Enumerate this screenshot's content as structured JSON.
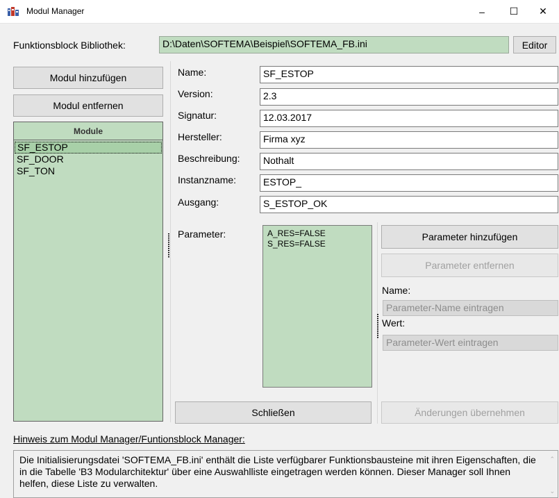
{
  "window": {
    "title": "Modul Manager",
    "minimize": "–",
    "maximize": "☐",
    "close": "✕"
  },
  "library": {
    "label": "Funktionsblock Bibliothek:",
    "path": "D:\\Daten\\SOFTEMA\\Beispiel\\SOFTEMA_FB.ini",
    "editor_button": "Editor"
  },
  "modules": {
    "add_button": "Modul hinzufügen",
    "remove_button": "Modul entfernen",
    "header": "Module",
    "items": [
      "SF_ESTOP",
      "SF_DOOR",
      "SF_TON"
    ],
    "selected_index": 0
  },
  "details": {
    "name_label": "Name:",
    "name_value": "SF_ESTOP",
    "version_label": "Version:",
    "version_value": "2.3",
    "signature_label": "Signatur:",
    "signature_value": "12.03.2017",
    "manufacturer_label": "Hersteller:",
    "manufacturer_value": "Firma xyz",
    "description_label": "Beschreibung:",
    "description_value": "Nothalt",
    "instance_label": "Instanzname:",
    "instance_value": "ESTOP_",
    "output_label": "Ausgang:",
    "output_value": "S_ESTOP_OK"
  },
  "parameters": {
    "label": "Parameter:",
    "items": [
      "A_RES=FALSE",
      "S_RES=FALSE"
    ],
    "add_button": "Parameter hinzufügen",
    "remove_button": "Parameter entfernen",
    "name_label": "Name:",
    "name_placeholder": "Parameter-Name eintragen",
    "value_label": "Wert:",
    "value_placeholder": "Parameter-Wert eintragen"
  },
  "actions": {
    "close_button": "Schließen",
    "apply_button": "Änderungen übernehmen"
  },
  "hint": {
    "title": "Hinweis zum Modul Manager/Funtionsblock Manager:",
    "text": "Die Initialisierungsdatei 'SOFTEMA_FB.ini' enthält die Liste verfügbarer Funktionsbausteine mit ihren Eigenschaften, die in die Tabelle 'B3 Modularchitektur' über eine Auswahlliste eingetragen werden können. Dieser Manager soll Ihnen helfen, diese Liste zu verwalten."
  }
}
